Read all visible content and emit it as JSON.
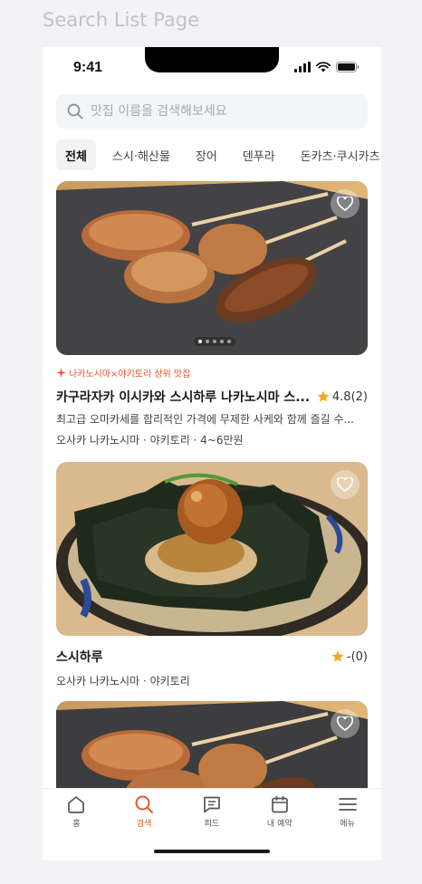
{
  "frame_title": "Search List Page",
  "status_bar": {
    "time": "9:41",
    "icons": [
      "signal-icon",
      "wifi-icon",
      "battery-icon"
    ]
  },
  "search": {
    "placeholder": "맛집 이름을 검색해보세요",
    "value": "",
    "icon": "search-icon"
  },
  "tabs": [
    {
      "label": "전체",
      "active": true
    },
    {
      "label": "스시·해산물",
      "active": false
    },
    {
      "label": "장어",
      "active": false
    },
    {
      "label": "덴푸라",
      "active": false
    },
    {
      "label": "돈카츠·쿠시카츠",
      "active": false
    }
  ],
  "restaurants": [
    {
      "promo": "나카노시마×야키토리 상위 맛집",
      "name": "카구라자카 이시카와 스시하루 나카노시마 스...",
      "rating": "4.8(2)",
      "description": "최고급 오마카세를 합리적인 가격에 무제한 사케와 함께 즐길 수...",
      "meta": "오사카 나카노시마 · 야키토리 · 4~6만원",
      "image": "yakitori skewers on stone plate",
      "carousel_pages": 5,
      "carousel_active": 1
    },
    {
      "promo": "",
      "name": "스시하루",
      "rating": "-(0)",
      "description": "",
      "meta": "오사카 나카노시마 · 야키토리",
      "image": "chicken with egg yolk on nori"
    },
    {
      "name": "",
      "image": "yakitori skewers on stone plate"
    }
  ],
  "bottom_nav": [
    {
      "label": "홈",
      "icon": "home-icon",
      "active": false
    },
    {
      "label": "검색",
      "icon": "search-icon",
      "active": true
    },
    {
      "label": "피드",
      "icon": "feed-icon",
      "active": false
    },
    {
      "label": "내 예약",
      "icon": "calendar-icon",
      "active": false
    },
    {
      "label": "메뉴",
      "icon": "menu-icon",
      "active": false
    }
  ],
  "colors": {
    "accent": "#e8542c",
    "star": "#f5a623",
    "text": "#1a1a1a",
    "search_bg": "#f4f5f7"
  }
}
